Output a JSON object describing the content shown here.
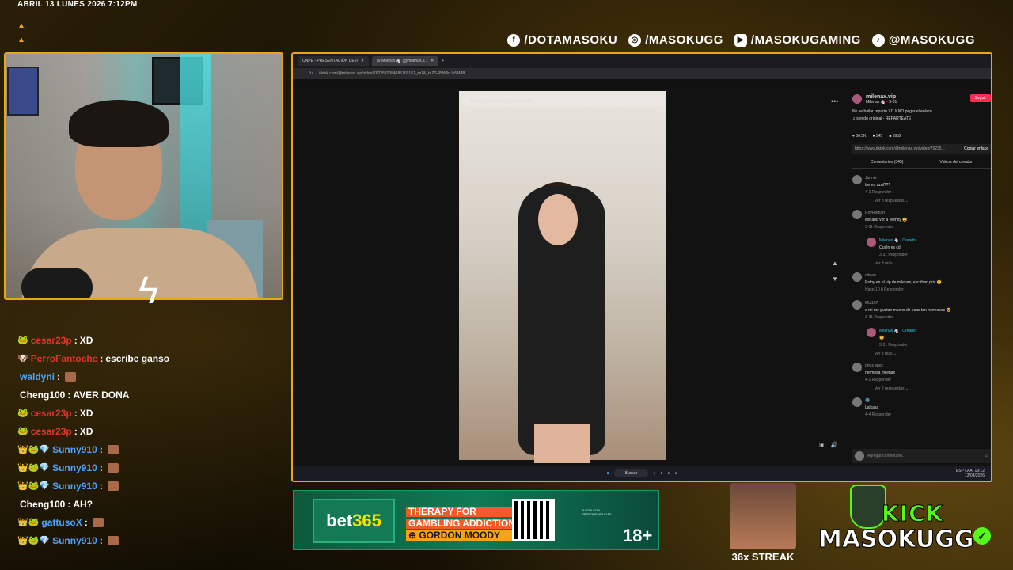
{
  "overlay": {
    "date": "ABRIL 13 LUNES 2026 7:12PM",
    "socials": [
      {
        "icon": "facebook-icon",
        "glyph": "f",
        "label": "/DOTAMASOKU"
      },
      {
        "icon": "instagram-icon",
        "glyph": "◎",
        "label": "/MASOKUGG"
      },
      {
        "icon": "youtube-icon",
        "glyph": "▶",
        "label": "/MASOKUGAMING"
      },
      {
        "icon": "tiktok-icon",
        "glyph": "♪",
        "label": "@MASOKUGG"
      }
    ],
    "accent": "#e6a817"
  },
  "chat": [
    {
      "name": "cesar23p",
      "color": "#e0352b",
      "badges": "🐸",
      "msg": "XD"
    },
    {
      "name": "PerroFantoche",
      "color": "#e0352b",
      "badges": "🐶",
      "msg": "escribe ganso"
    },
    {
      "name": "waldyni",
      "color": "#4da3ff",
      "badges": "",
      "msg": "",
      "emote": true
    },
    {
      "name": "Cheng100",
      "color": "#ffffff",
      "badges": "",
      "msg": "AVER DONA"
    },
    {
      "name": "cesar23p",
      "color": "#e0352b",
      "badges": "🐸",
      "msg": "XD"
    },
    {
      "name": "cesar23p",
      "color": "#e0352b",
      "badges": "🐸",
      "msg": "XD"
    },
    {
      "name": "Sunny910",
      "color": "#4da3ff",
      "badges": "👑🐸💎",
      "msg": "",
      "emote": true
    },
    {
      "name": "Sunny910",
      "color": "#4da3ff",
      "badges": "👑🐸💎",
      "msg": "",
      "emote": true
    },
    {
      "name": "Sunny910",
      "color": "#4da3ff",
      "badges": "👑🐸💎",
      "msg": "",
      "emote": true
    },
    {
      "name": "Cheng100",
      "color": "#ffffff",
      "badges": "",
      "msg": "AH?"
    },
    {
      "name": "gattusoX",
      "color": "#4da3ff",
      "badges": "👑🐸",
      "msg": "",
      "emote": true
    },
    {
      "name": "Sunny910",
      "color": "#4da3ff",
      "badges": "👑🐸💎",
      "msg": "",
      "emote": true
    }
  ],
  "browser": {
    "tabs": [
      "CNPE - PRESENTACIÓN DE II",
      "(9)Milenax 🦄 (@milenax.v..."
    ],
    "url": "tiktok.com/@milenax.vip/video/7623570384185769167_r=1&_t=ZS-95W9rUe5M4B",
    "search_placeholder": "Buscar contenido relacionado",
    "profile": {
      "handle": "milenax.vip",
      "name": "Milenax 🦄 · 3-31",
      "follow": "Seguir",
      "caption": "No se bailar reparto XD // NO pegar el enlace",
      "sound": "♫ sonido original - REPARTEATE"
    },
    "stats": {
      "likes": "56.5K",
      "comments": "345",
      "saves": "5952"
    },
    "link": "https://www.tiktok.com/@milenax.vip/video/76235...",
    "copy": "Copiar enlace",
    "tab_comments": "Comentarios (345)",
    "tab_creator": "Videos del creador",
    "comments": [
      {
        "user": "Jannie",
        "text": "tienes azul???",
        "meta": "4-1   Responder",
        "more": "Ver 8 respuestas ⌄"
      },
      {
        "user": "RoyRoman",
        "text": "extraño ver a Wendy 😩",
        "meta": "3-31   Responder",
        "reply_user": "Milenax 🦄 · Creador",
        "reply_text": "Quién es cd",
        "reply_meta": "3-31   Responder",
        "more": "Ver 3 más ⌄"
      },
      {
        "user": "crlean",
        "text": "Estoy en el vip de milenax, escriban priv 😩",
        "meta": "Hace 10 h   Responder"
      },
      {
        "user": "Mtz107",
        "text": "a mi me gustan mucho de esas tan hermosas 😍",
        "meta": "3-31   Responder",
        "reply_user": "Milenax 🦄 · Creador",
        "reply_text": "😊",
        "reply_meta": "3-31   Responder",
        "more": "Ver 3 más ⌄"
      },
      {
        "user": "onus enoc",
        "text": "hermosa milenax",
        "meta": "4-1   Responder",
        "more": "Ver 2 respuestas ⌄"
      },
      {
        "user": "🌚",
        "text": "Lalkasa",
        "meta": "4-4   Responder"
      }
    ],
    "comment_placeholder": "Agregar comentario...",
    "taskbar_search": "Buscar",
    "clock_time": "19:12",
    "clock_date": "13/04/2026",
    "lang": "ESP LAA"
  },
  "ad": {
    "logo_a": "bet",
    "logo_b": "365",
    "line1": "THERAPY FOR",
    "line2": "GAMBLING ADDICTION",
    "line3": "⊕ GORDON MOODY",
    "small": "JUEGA CON RESPONSABILIDAD",
    "age": "18+"
  },
  "streak": "36x STREAK",
  "brand": {
    "kick": "KICK",
    "name": "MASOKUGG",
    "green": "#53fc18"
  }
}
